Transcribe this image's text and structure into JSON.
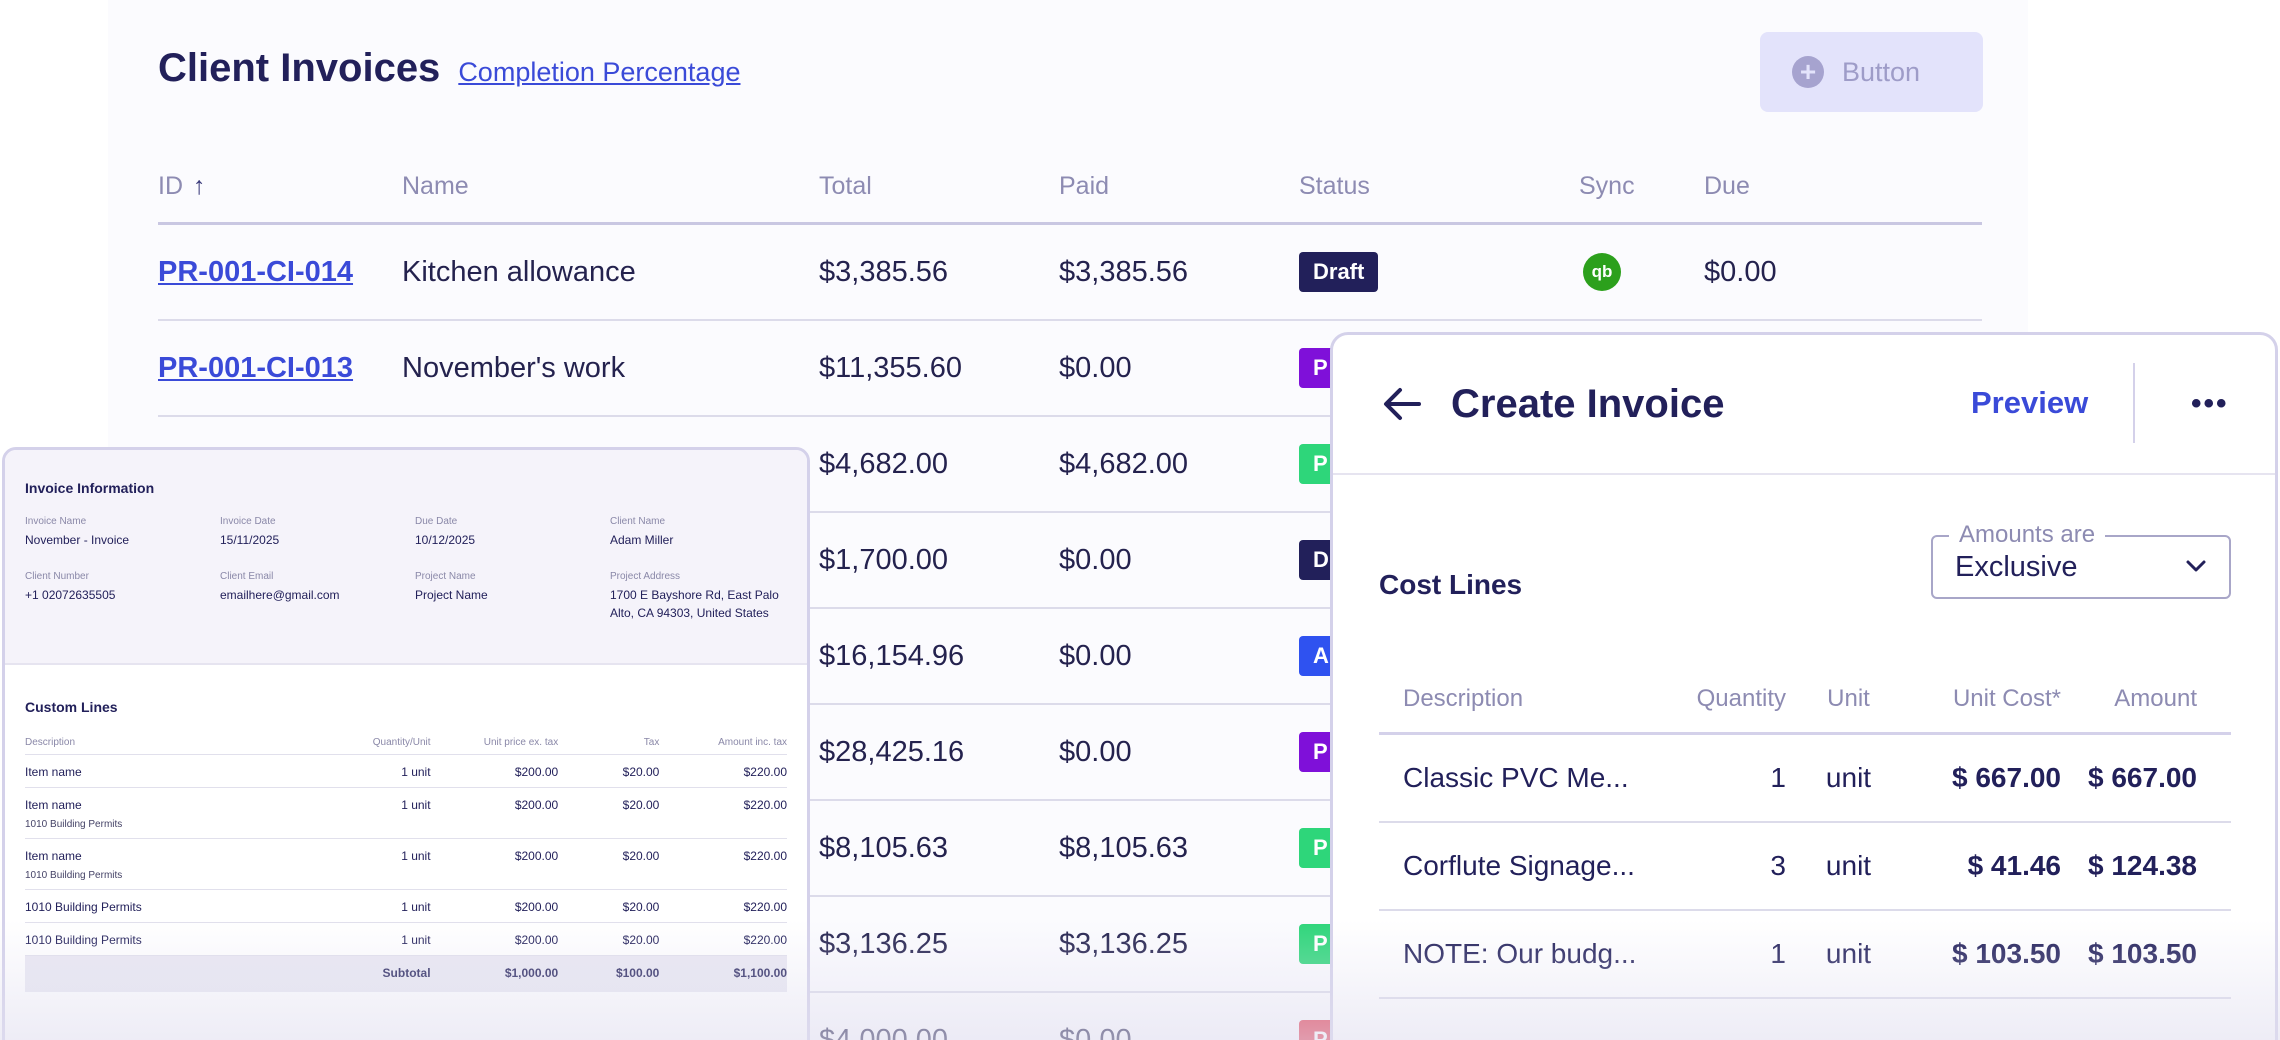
{
  "header": {
    "title": "Client Invoices",
    "link": "Completion Percentage",
    "button_label": "Button"
  },
  "list": {
    "columns": [
      "ID",
      "Name",
      "Total",
      "Paid",
      "Status",
      "Sync",
      "Due"
    ],
    "sort_indicator": "↑",
    "rows": [
      {
        "id": "PR-001-CI-014",
        "name": "Kitchen allowance",
        "total": "$3,385.56",
        "paid": "$3,385.56",
        "status": "Draft",
        "status_color": "#22205a",
        "sync": "qb",
        "due": "$0.00"
      },
      {
        "id": "PR-001-CI-013",
        "name": "November's work",
        "total": "$11,355.60",
        "paid": "$0.00",
        "status": "P",
        "status_color": "#7f10d9",
        "sync": "",
        "due": ""
      },
      {
        "id": "",
        "name": "",
        "total": "$4,682.00",
        "paid": "$4,682.00",
        "status": "P",
        "status_color": "#2ed67a",
        "sync": "",
        "due": ""
      },
      {
        "id": "",
        "name": "",
        "total": "$1,700.00",
        "paid": "$0.00",
        "status": "D",
        "status_color": "#22205a",
        "sync": "",
        "due": ""
      },
      {
        "id": "",
        "name": "",
        "total": "$16,154.96",
        "paid": "$0.00",
        "status": "A",
        "status_color": "#2f52f0",
        "sync": "",
        "due": ""
      },
      {
        "id": "",
        "name": "",
        "total": "$28,425.16",
        "paid": "$0.00",
        "status": "P",
        "status_color": "#7f10d9",
        "sync": "",
        "due": ""
      },
      {
        "id": "",
        "name": "",
        "total": "$8,105.63",
        "paid": "$8,105.63",
        "status": "P",
        "status_color": "#2ed67a",
        "sync": "",
        "due": ""
      },
      {
        "id": "",
        "name": "",
        "total": "$3,136.25",
        "paid": "$3,136.25",
        "status": "P",
        "status_color": "#2ed67a",
        "sync": "",
        "due": ""
      },
      {
        "id": "",
        "name": "",
        "total": "$4,000.00",
        "paid": "$0.00",
        "status": "P",
        "status_color": "#e0354a",
        "sync": "",
        "due": ""
      }
    ]
  },
  "invoice": {
    "info_title": "Invoice Information",
    "fields": [
      {
        "label": "Invoice Name",
        "value": "November - Invoice"
      },
      {
        "label": "Invoice Date",
        "value": "15/11/2025"
      },
      {
        "label": "Due Date",
        "value": "10/12/2025"
      },
      {
        "label": "Client Name",
        "value": "Adam Miller"
      },
      {
        "label": "Client Number",
        "value": "+1 02072635505"
      },
      {
        "label": "Client Email",
        "value": "emailhere@gmail.com"
      },
      {
        "label": "Project Name",
        "value": "Project Name"
      },
      {
        "label": "Project Address",
        "value": "1700 E Bayshore Rd, East Palo Alto, CA 94303, United States"
      }
    ],
    "lines_title": "Custom Lines",
    "line_columns": [
      "Description",
      "Quantity/Unit",
      "Unit price ex. tax",
      "Tax",
      "Amount inc. tax"
    ],
    "lines": [
      {
        "desc": "Item name",
        "sub": "",
        "qty": "1 unit",
        "price": "$200.00",
        "tax": "$20.00",
        "amount": "$220.00"
      },
      {
        "desc": "Item name",
        "sub": "1010 Building Permits",
        "qty": "1 unit",
        "price": "$200.00",
        "tax": "$20.00",
        "amount": "$220.00"
      },
      {
        "desc": "Item name",
        "sub": "1010 Building Permits",
        "qty": "1 unit",
        "price": "$200.00",
        "tax": "$20.00",
        "amount": "$220.00"
      },
      {
        "desc": "1010 Building Permits",
        "sub": "",
        "qty": "1 unit",
        "price": "$200.00",
        "tax": "$20.00",
        "amount": "$220.00"
      },
      {
        "desc": "1010 Building Permits",
        "sub": "",
        "qty": "1 unit",
        "price": "$200.00",
        "tax": "$20.00",
        "amount": "$220.00"
      }
    ],
    "subtotal": {
      "label": "Subtotal",
      "price": "$1,000.00",
      "tax": "$100.00",
      "amount": "$1,100.00"
    }
  },
  "create": {
    "title": "Create Invoice",
    "preview_label": "Preview",
    "section_title": "Cost Lines",
    "amounts_label": "Amounts are",
    "amounts_value": "Exclusive",
    "columns": [
      "Description",
      "Quantity",
      "Unit",
      "Unit Cost*",
      "Amount"
    ],
    "rows": [
      {
        "desc": "Classic PVC Me...",
        "qty": "1",
        "unit": "unit",
        "cost": "$ 667.00",
        "amount": "$ 667.00"
      },
      {
        "desc": "Corflute Signage...",
        "qty": "3",
        "unit": "unit",
        "cost": "$ 41.46",
        "amount": "$ 124.38"
      },
      {
        "desc": "NOTE: Our budg...",
        "qty": "1",
        "unit": "unit",
        "cost": "$ 103.50",
        "amount": "$ 103.50"
      }
    ]
  }
}
